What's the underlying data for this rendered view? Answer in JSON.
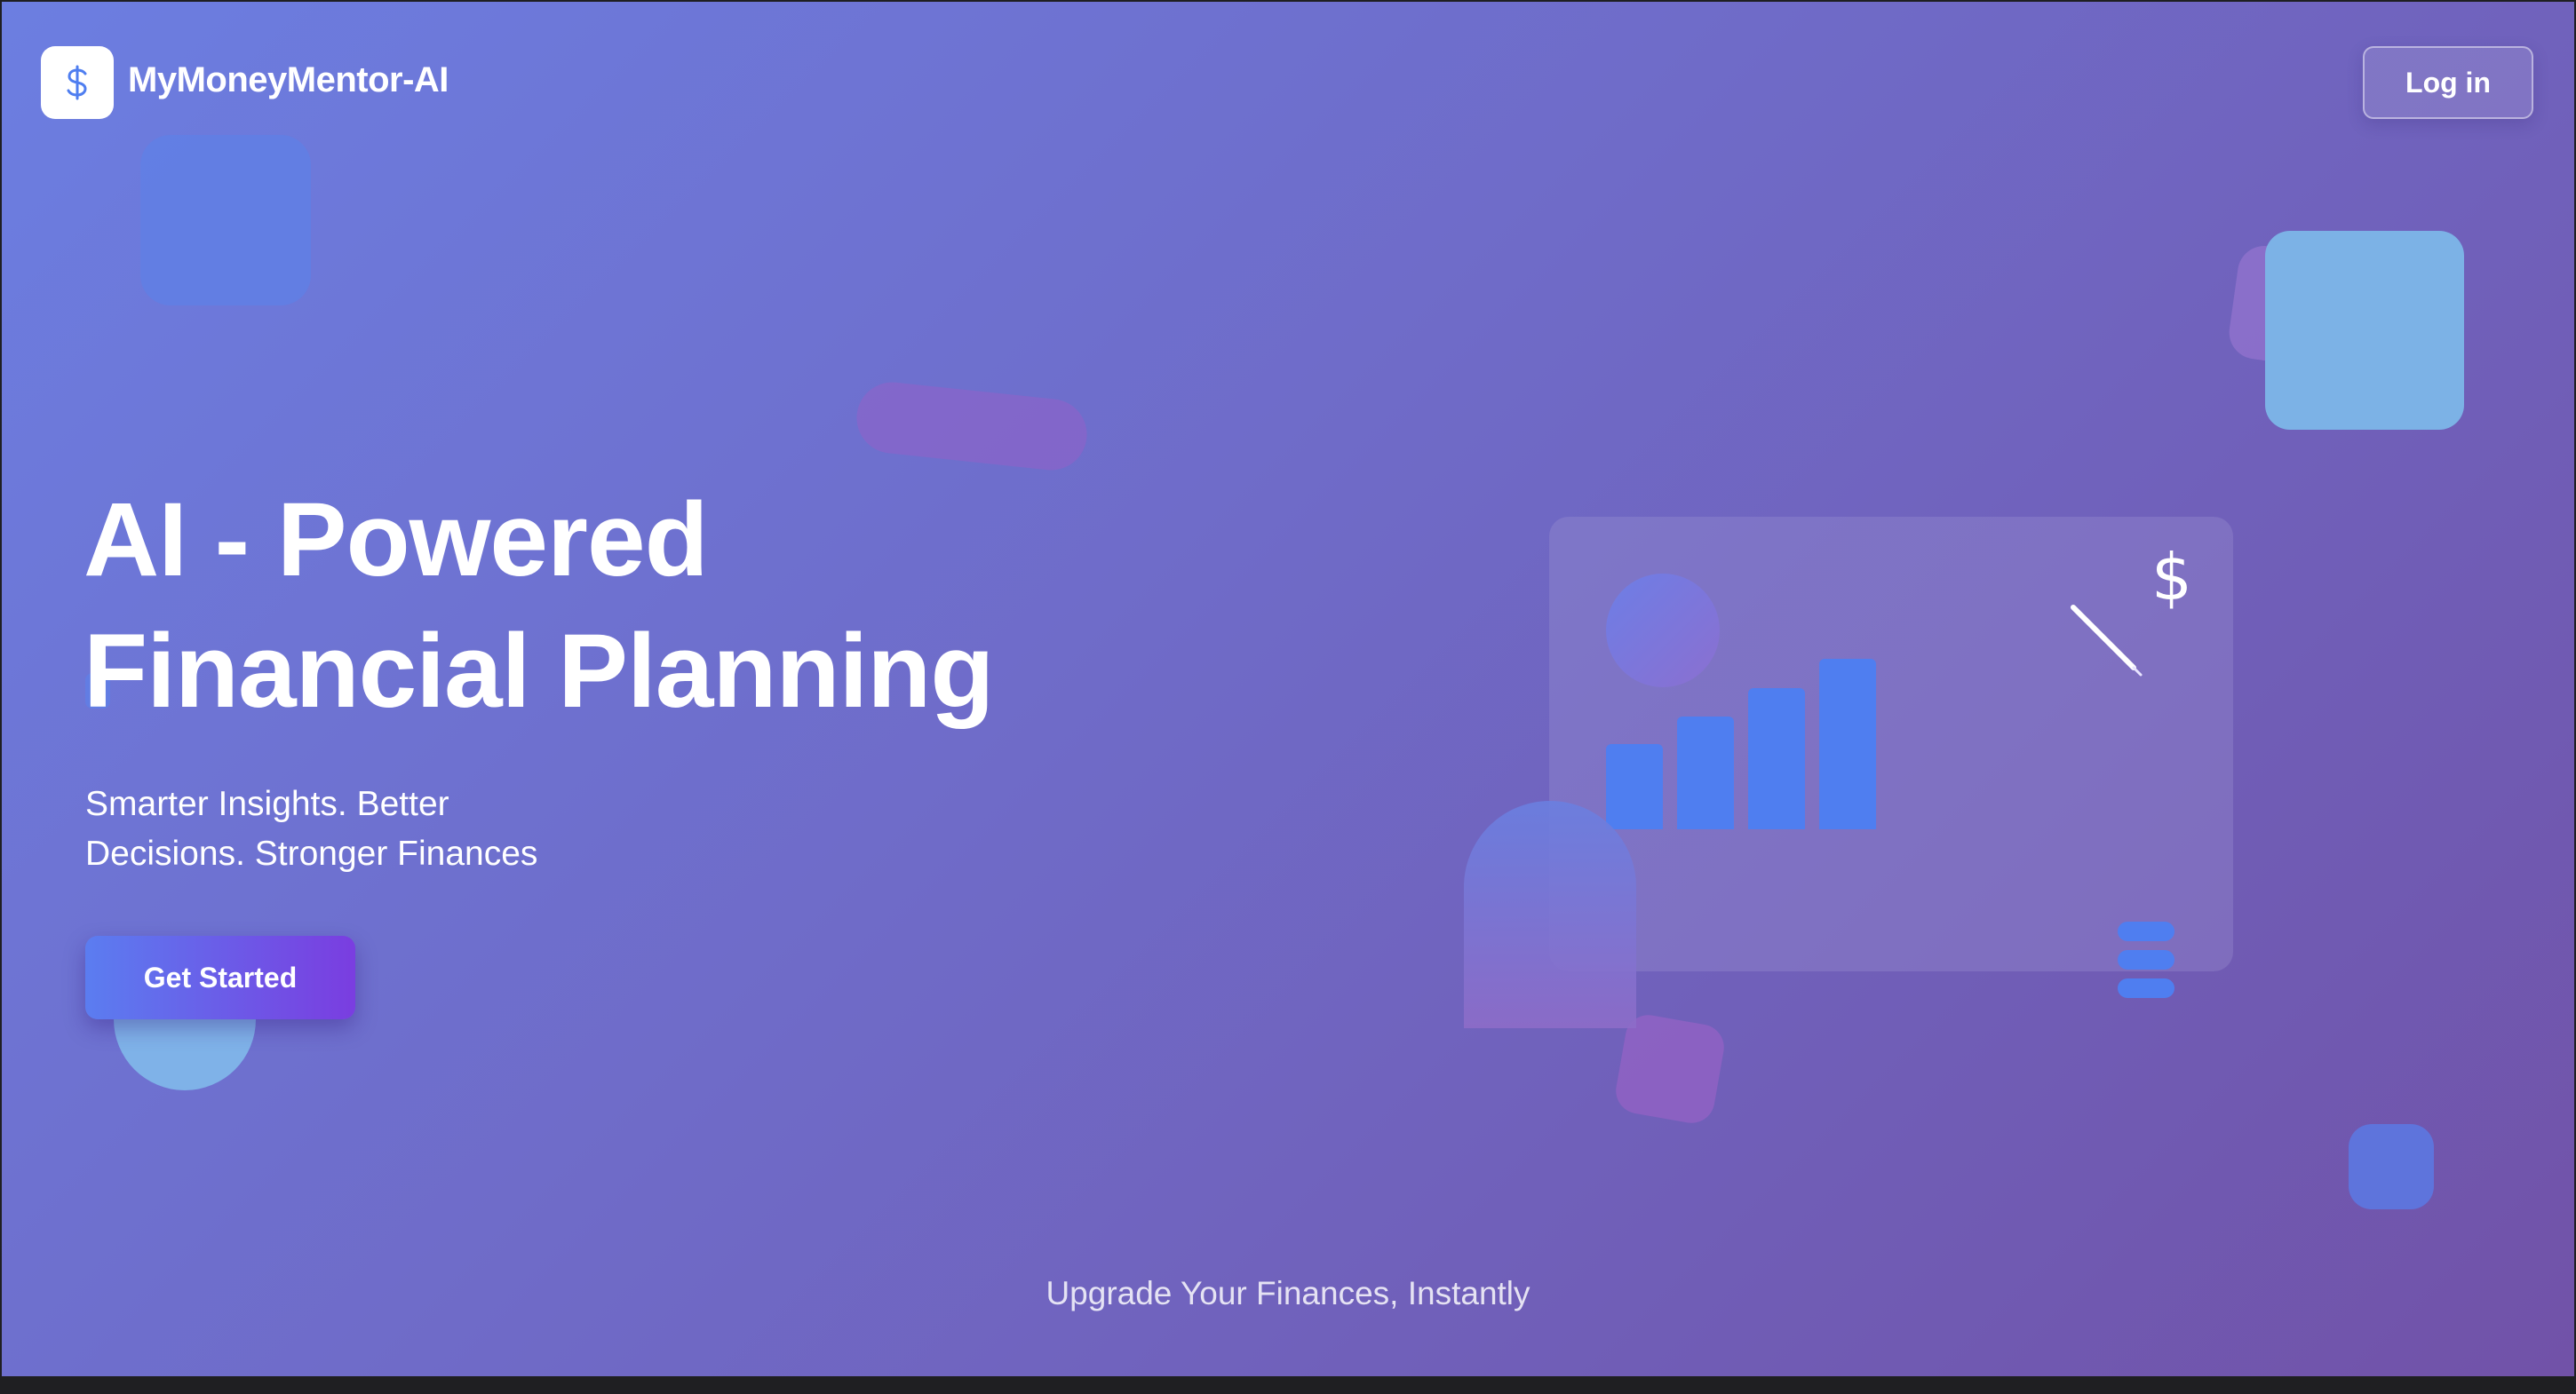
{
  "header": {
    "app_name": "MyMoneyMentor-AI",
    "logo_icon": "dollar-icon",
    "login_label": "Log in"
  },
  "hero": {
    "title_line1": "AI - Powered",
    "title_line2": "Financial Planning",
    "subtitle_line1": "Smarter Insights. Better",
    "subtitle_line2": "Decisions. Stronger Finances",
    "cta_label": "Get Started"
  },
  "illustration": {
    "currency_symbol": "$",
    "icons": [
      "bar-chart-icon",
      "pen-icon",
      "coin-stack-icon"
    ],
    "bar_levels": [
      0.5,
      0.66,
      0.83,
      1.0
    ]
  },
  "footer": {
    "tagline": "Upgrade Your Finances, Instantly"
  },
  "colors": {
    "background_start": "#6c7ee1",
    "background_end": "#7152a8",
    "accent_blue": "#4f7ef0",
    "cta_start": "#5b7df0",
    "cta_end": "#7a3de0"
  }
}
